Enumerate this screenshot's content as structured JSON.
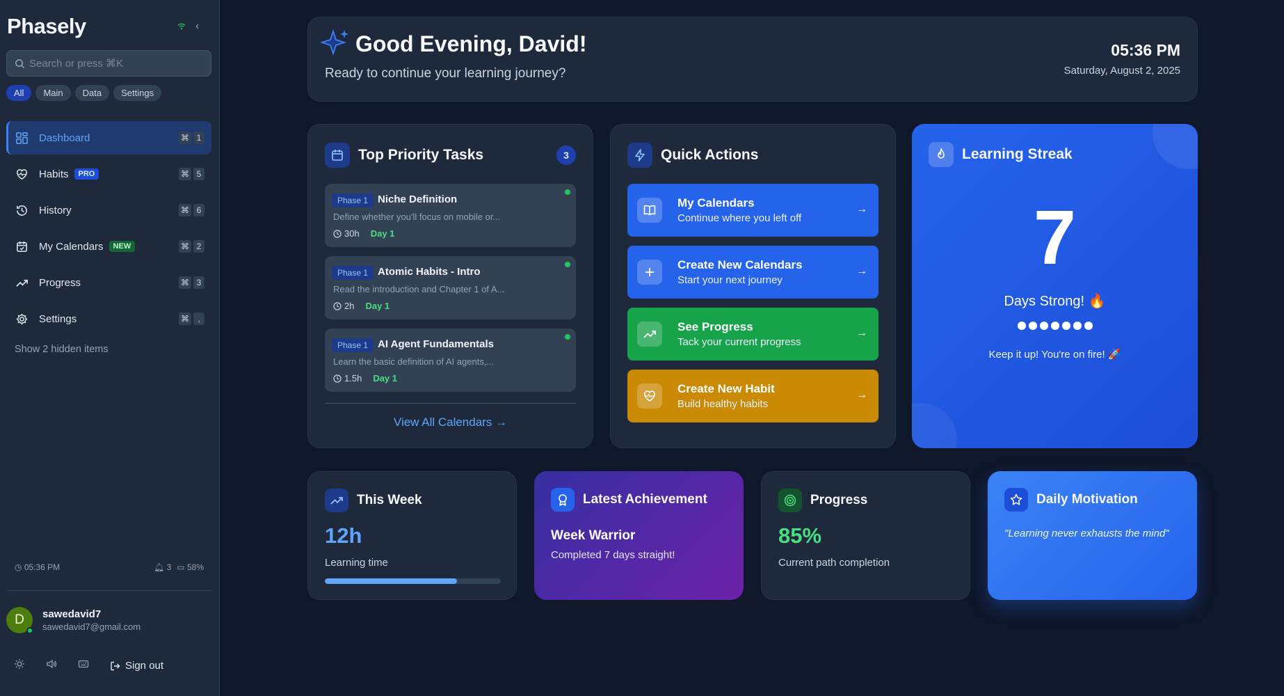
{
  "sidebar": {
    "logo": "Phasely",
    "search_placeholder": "Search or press ⌘K",
    "filters": [
      "All",
      "Main",
      "Data",
      "Settings"
    ],
    "items": [
      {
        "label": "Dashboard",
        "icon": "dashboard-icon",
        "key": "1",
        "active": true
      },
      {
        "label": "Habits",
        "icon": "heart-pulse-icon",
        "key": "5",
        "badge": "PRO"
      },
      {
        "label": "History",
        "icon": "history-icon",
        "key": "6"
      },
      {
        "label": "My Calendars",
        "icon": "calendar-check-icon",
        "key": "2",
        "badge": "NEW"
      },
      {
        "label": "Progress",
        "icon": "trending-up-icon",
        "key": "3"
      },
      {
        "label": "Settings",
        "icon": "gear-icon",
        "key": ","
      }
    ],
    "cmd_symbol": "⌘",
    "hidden_items": "Show 2 hidden items",
    "status": {
      "time": "05:36 PM",
      "notifications": "3",
      "battery": "58%"
    },
    "user": {
      "initial": "D",
      "name": "sawedavid7",
      "email": "sawedavid7@gmail.com"
    },
    "sign_out": "Sign out"
  },
  "greeting": {
    "title": "Good Evening, David!",
    "subtitle": "Ready to continue your learning journey?",
    "time": "05:36 PM",
    "date": "Saturday, August 2, 2025"
  },
  "tasks": {
    "title": "Top Priority Tasks",
    "count": "3",
    "items": [
      {
        "phase": "Phase 1",
        "name": "Niche Definition",
        "desc": "Define whether you'll focus on mobile or...",
        "duration": "30h",
        "day": "Day 1"
      },
      {
        "phase": "Phase 1",
        "name": "Atomic Habits - Intro",
        "desc": "Read the introduction and Chapter 1 of A...",
        "duration": "2h",
        "day": "Day 1"
      },
      {
        "phase": "Phase 1",
        "name": "AI Agent Fundamentals",
        "desc": "Learn the basic definition of AI agents,...",
        "duration": "1.5h",
        "day": "Day 1"
      }
    ],
    "view_all": "View All Calendars"
  },
  "quick_actions": {
    "title": "Quick Actions",
    "items": [
      {
        "title": "My Calendars",
        "sub": "Continue where you left off",
        "color": "#2563eb"
      },
      {
        "title": "Create New Calendars",
        "sub": "Start your next journey",
        "color": "#2563eb"
      },
      {
        "title": "See Progress",
        "sub": "Tack your current progress",
        "color": "#16a34a"
      },
      {
        "title": "Create New Habit",
        "sub": "Build healthy habits",
        "color": "#ca8a04"
      }
    ]
  },
  "streak": {
    "title": "Learning Streak",
    "value": "7",
    "label": "Days Strong! 🔥",
    "dots": 7,
    "message": "Keep it up! You're on fire! 🚀"
  },
  "stats": {
    "week": {
      "title": "This Week",
      "value": "12h",
      "label": "Learning time",
      "progress_percent": 75
    },
    "achievement": {
      "title": "Latest Achievement",
      "name": "Week Warrior",
      "desc": "Completed 7 days straight!"
    },
    "progress": {
      "title": "Progress",
      "value": "85%",
      "label": "Current path completion"
    },
    "motivation": {
      "title": "Daily Motivation",
      "quote": "\"Learning never exhausts the mind\""
    }
  },
  "colors": {
    "accent": "#3b82f6",
    "success": "#22c55e",
    "background": "#0f172a",
    "surface": "#1e293b"
  }
}
